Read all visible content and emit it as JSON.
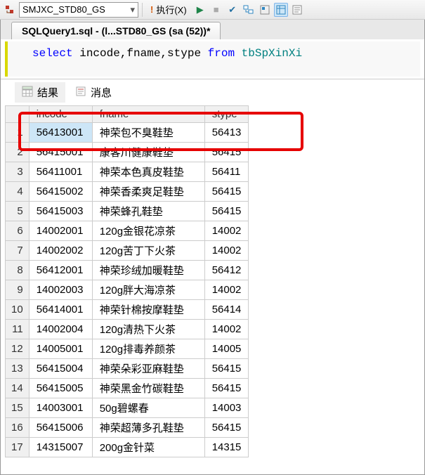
{
  "toolbar": {
    "db_name": "SMJXC_STD80_GS",
    "execute_label": "执行(X)"
  },
  "file_tab": {
    "title": "SQLQuery1.sql - (l...STD80_GS (sa (52))*"
  },
  "sql": {
    "kw_select": "select",
    "cols": " incode,fname,stype ",
    "kw_from": "from",
    "table": " tbSpXinXi"
  },
  "result_tabs": {
    "results": "结果",
    "messages": "消息"
  },
  "grid": {
    "headers": {
      "c1": "incode",
      "c2": "fname",
      "c3": "stype"
    },
    "rows": [
      {
        "n": "1",
        "incode": "56413001",
        "fname": "神荣包不臭鞋垫",
        "stype": "56413"
      },
      {
        "n": "2",
        "incode": "56415001",
        "fname": "康客川健康鞋垫",
        "stype": "56415"
      },
      {
        "n": "3",
        "incode": "56411001",
        "fname": "神荣本色真皮鞋垫",
        "stype": "56411"
      },
      {
        "n": "4",
        "incode": "56415002",
        "fname": "神荣香柔爽足鞋垫",
        "stype": "56415"
      },
      {
        "n": "5",
        "incode": "56415003",
        "fname": "神荣蜂孔鞋垫",
        "stype": "56415"
      },
      {
        "n": "6",
        "incode": "14002001",
        "fname": "120g金银花凉茶",
        "stype": "14002"
      },
      {
        "n": "7",
        "incode": "14002002",
        "fname": "120g苦丁下火茶",
        "stype": "14002"
      },
      {
        "n": "8",
        "incode": "56412001",
        "fname": "神荣珍绒加暖鞋垫",
        "stype": "56412"
      },
      {
        "n": "9",
        "incode": "14002003",
        "fname": "120g胖大海凉茶",
        "stype": "14002"
      },
      {
        "n": "10",
        "incode": "56414001",
        "fname": "神荣针棉按摩鞋垫",
        "stype": "56414"
      },
      {
        "n": "11",
        "incode": "14002004",
        "fname": "120g清热下火茶",
        "stype": "14002"
      },
      {
        "n": "12",
        "incode": "14005001",
        "fname": "120g排毒养颜茶",
        "stype": "14005"
      },
      {
        "n": "13",
        "incode": "56415004",
        "fname": "神荣朵彩亚麻鞋垫",
        "stype": "56415"
      },
      {
        "n": "14",
        "incode": "56415005",
        "fname": "神荣黑金竹碳鞋垫",
        "stype": "56415"
      },
      {
        "n": "15",
        "incode": "14003001",
        "fname": "50g碧螺春",
        "stype": "14003"
      },
      {
        "n": "16",
        "incode": "56415006",
        "fname": "神荣超薄多孔鞋垫",
        "stype": "56415"
      },
      {
        "n": "17",
        "incode": "14315007",
        "fname": "200g金针菜",
        "stype": "14315"
      }
    ]
  }
}
